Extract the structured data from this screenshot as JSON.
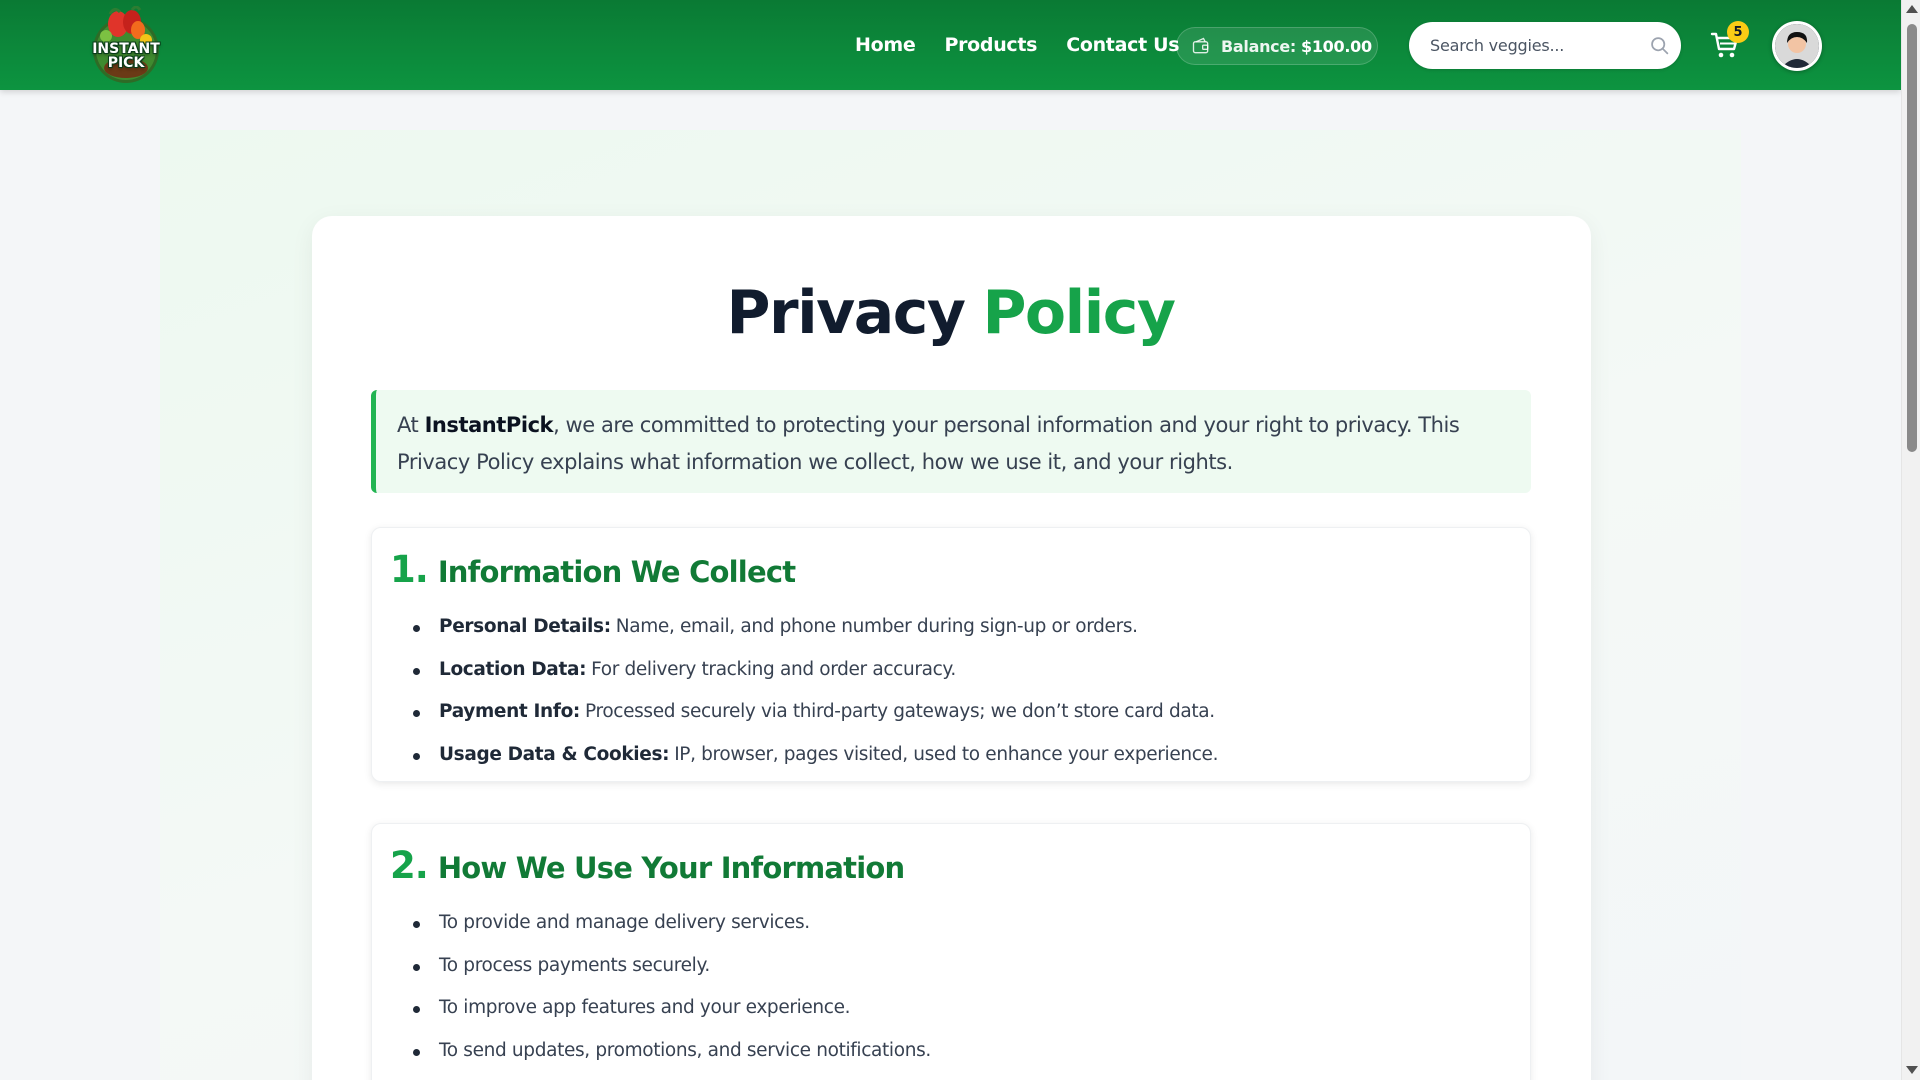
{
  "header": {
    "logo_text_line1": "INSTANT",
    "logo_text_line2": "PICK",
    "nav": [
      "Home",
      "Products",
      "Contact Us"
    ],
    "balance_label": "Balance:",
    "balance_value": "$100.00",
    "search_placeholder": "Search veggies...",
    "cart_count": "5"
  },
  "page": {
    "title_part1": "Privacy",
    "title_part2": "Policy",
    "intro_prefix": "At ",
    "intro_brand": "InstantPick",
    "intro_rest": ", we are committed to protecting your personal information and your right to privacy. This Privacy Policy explains what information we collect, how we use it, and your rights."
  },
  "sections": [
    {
      "number": "1.",
      "title": "Information We Collect",
      "items": [
        {
          "key": "Personal Details:",
          "text": "Name, email, and phone number during sign-up or orders."
        },
        {
          "key": "Location Data:",
          "text": "For delivery tracking and order accuracy."
        },
        {
          "key": "Payment Info:",
          "text": "Processed securely via third-party gateways; we don’t store card data."
        },
        {
          "key": "Usage Data & Cookies:",
          "text": "IP, browser, pages visited, used to enhance your experience."
        }
      ]
    },
    {
      "number": "2.",
      "title": "How We Use Your Information",
      "items": [
        {
          "text": "To provide and manage delivery services."
        },
        {
          "text": "To process payments securely."
        },
        {
          "text": "To improve app features and your experience."
        },
        {
          "text": "To send updates, promotions, and service notifications."
        }
      ]
    }
  ],
  "colors": {
    "header_green": "#0d9440",
    "accent_green": "#16a34a",
    "heading_dark": "#111c2e",
    "badge_yellow": "#facc15"
  },
  "icons": {
    "balance": "wallet-icon",
    "search": "search-icon",
    "cart": "cart-icon",
    "avatar": "user-avatar-icon"
  }
}
